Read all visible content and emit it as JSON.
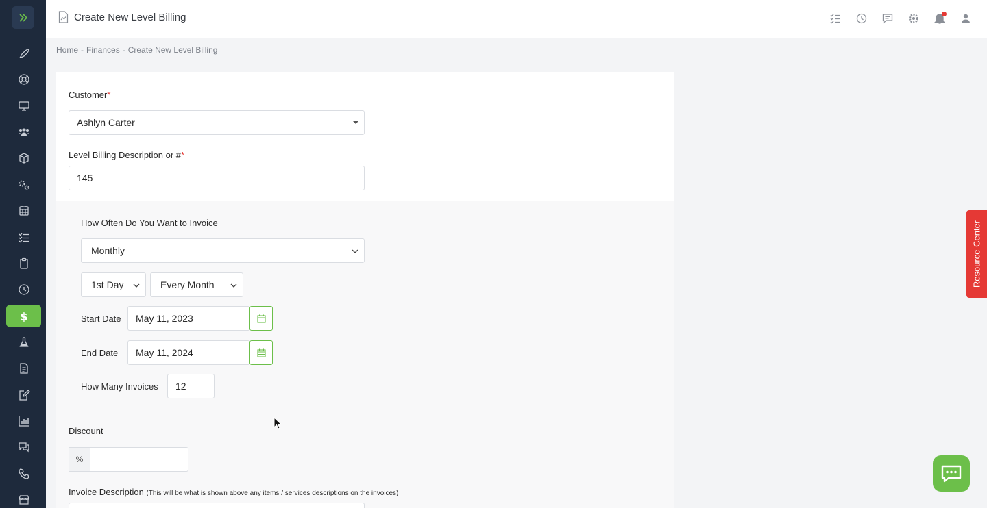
{
  "header": {
    "title": "Create New Level Billing"
  },
  "breadcrumb": {
    "items": [
      "Home",
      "Finances",
      "Create New Level Billing"
    ],
    "separator": "-"
  },
  "form": {
    "customer": {
      "label": "Customer",
      "required_mark": "*",
      "value": "Ashlyn Carter"
    },
    "description": {
      "label": "Level Billing Description or #",
      "required_mark": "*",
      "value": "145"
    },
    "frequency": {
      "label": "How Often Do You Want to Invoice",
      "value": "Monthly"
    },
    "day": {
      "value": "1st Day"
    },
    "interval": {
      "value": "Every Month"
    },
    "start_date": {
      "label": "Start Date",
      "value": "May 11, 2023"
    },
    "end_date": {
      "label": "End Date",
      "value": "May 11, 2024"
    },
    "invoice_count": {
      "label": "How Many Invoices",
      "value": "12"
    },
    "discount": {
      "label": "Discount",
      "unit": "%",
      "value": ""
    },
    "invoice_description": {
      "label": "Invoice Description",
      "note": "(This will be what is shown above any items / services descriptions on the invoices)"
    }
  },
  "resource_center": {
    "label": "Resource Center"
  },
  "colors": {
    "sidebar_bg": "#1e2a3c",
    "accent_green": "#6cbf4a",
    "alert_red": "#e53935"
  },
  "sidebar_icons": [
    "rocket-icon",
    "lifebuoy-icon",
    "monitor-icon",
    "users-icon",
    "box-icon",
    "gears-icon",
    "calendar-icon",
    "checklist-icon",
    "clipboard-icon",
    "clock-icon",
    "dollar-icon",
    "flask-icon",
    "document-icon",
    "edit-document-icon",
    "bar-chart-icon",
    "chat-icon",
    "phone-icon",
    "store-icon"
  ]
}
